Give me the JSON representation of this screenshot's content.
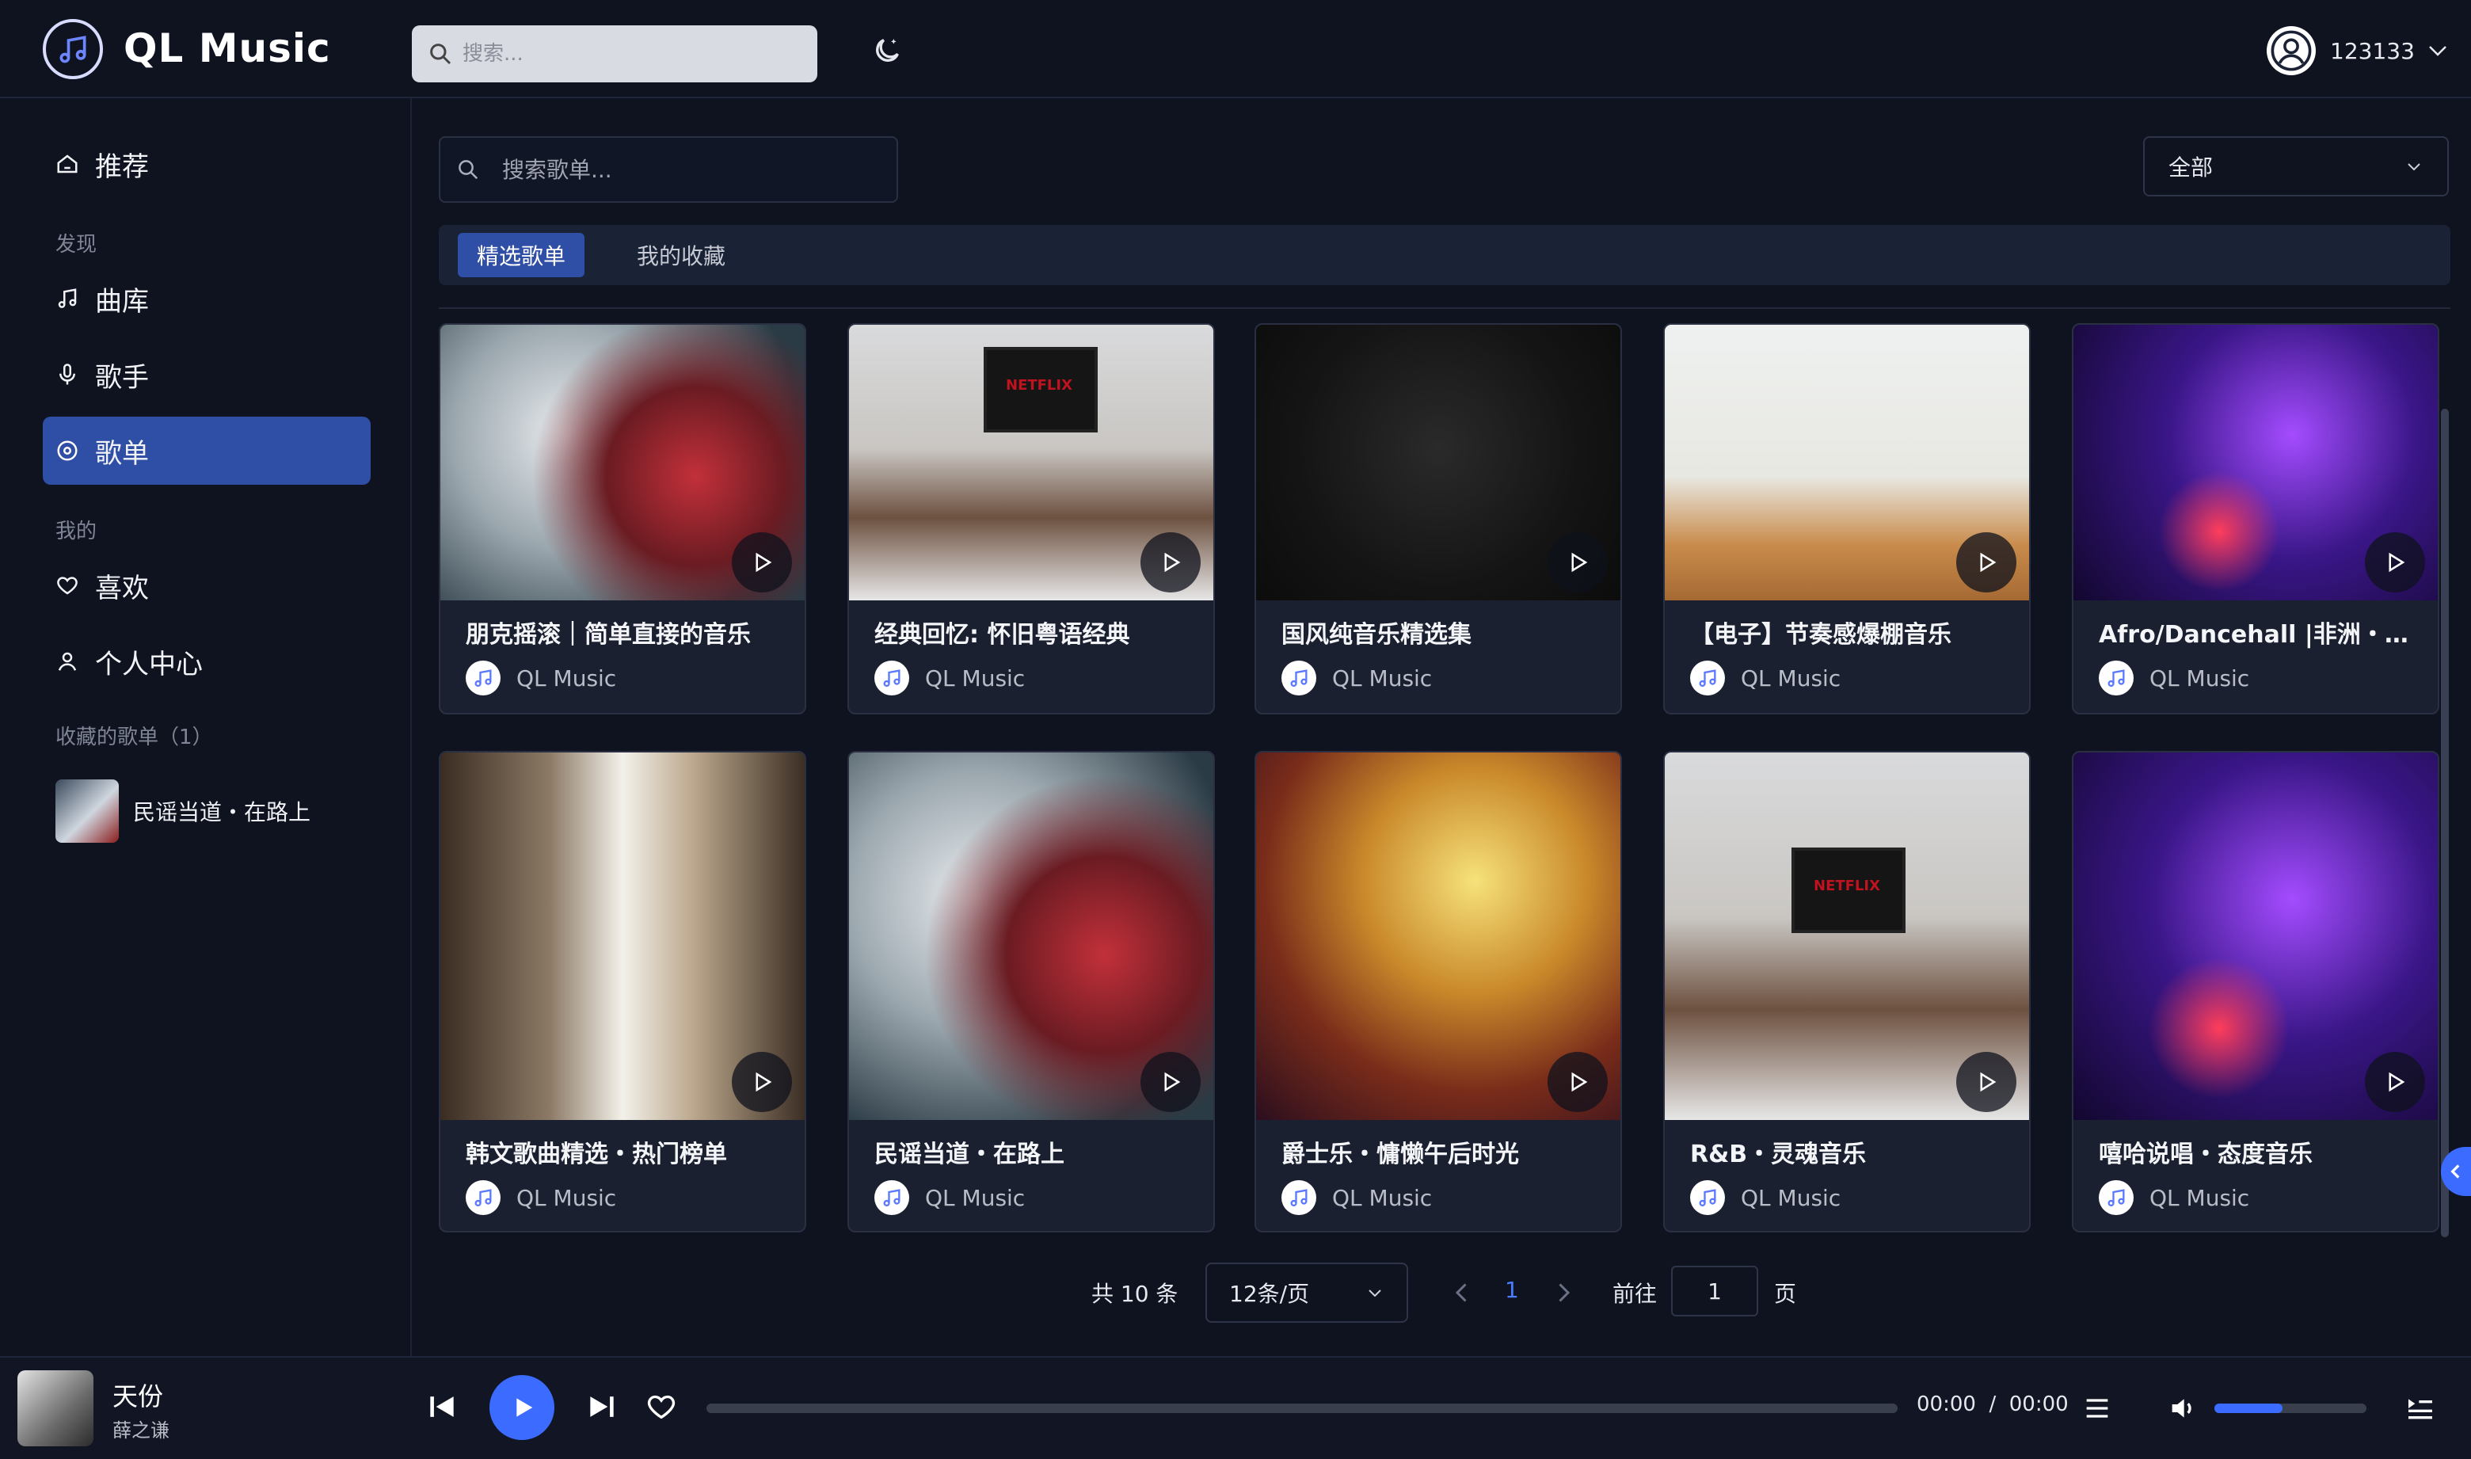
{
  "header": {
    "app_name": "QL Music",
    "search_placeholder": "搜索...",
    "username": "123133"
  },
  "sidebar": {
    "recommend": "推荐",
    "section_discover": "发现",
    "library": "曲库",
    "singers": "歌手",
    "playlists": "歌单",
    "section_mine": "我的",
    "likes": "喜欢",
    "profile": "个人中心",
    "section_fav_playlists": "收藏的歌单（1）",
    "fav_playlist_name": "民谣当道・在路上"
  },
  "main": {
    "search_placeholder": "搜索歌单...",
    "filter_value": "全部",
    "tabs": [
      {
        "label": "精选歌单",
        "active": true
      },
      {
        "label": "我的收藏",
        "active": false
      }
    ],
    "cards": [
      {
        "title": "朋克摇滚｜简单直接的音乐",
        "author": "QL Music",
        "theme": "rock"
      },
      {
        "title": "经典回忆: 怀旧粤语经典",
        "author": "QL Music",
        "theme": "room"
      },
      {
        "title": "国风纯音乐精选集",
        "author": "QL Music",
        "theme": "dark"
      },
      {
        "title": "【电子】节奏感爆棚音乐",
        "author": "QL Music",
        "theme": "fit"
      },
      {
        "title": "Afro/Dancehall |非洲・牙…",
        "author": "QL Music",
        "theme": "dj"
      },
      {
        "title": "韩文歌曲精选・热门榜单",
        "author": "QL Music",
        "theme": "study"
      },
      {
        "title": "民谣当道・在路上",
        "author": "QL Music",
        "theme": "rock"
      },
      {
        "title": "爵士乐・慵懒午后时光",
        "author": "QL Music",
        "theme": "sax"
      },
      {
        "title": "R&B・灵魂音乐",
        "author": "QL Music",
        "theme": "room"
      },
      {
        "title": "嘻哈说唱・态度音乐",
        "author": "QL Music",
        "theme": "dj"
      }
    ],
    "tv_brand": "NETFLIX",
    "pagination": {
      "total_text": "共 10 条",
      "page_size": "12条/页",
      "current_page": "1",
      "goto_label": "前往",
      "goto_value": "1",
      "page_suffix": "页"
    }
  },
  "player": {
    "song_title": "天份",
    "artist": "薛之谦",
    "time_text": "00:00  /  00:00",
    "progress": 0,
    "volume": 0.45
  },
  "colors": {
    "accent": "#3b6cff",
    "active_nav": "#2f4ea6",
    "background": "#0f1320",
    "card": "#1b2030"
  }
}
